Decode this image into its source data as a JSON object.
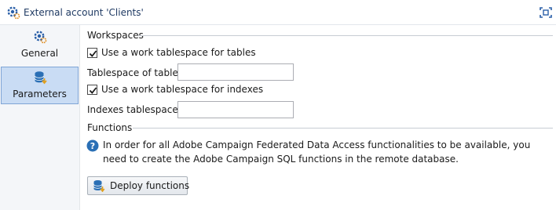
{
  "window": {
    "title": "External account 'Clients'"
  },
  "sidebar": {
    "items": [
      {
        "label": "General",
        "icon": "gear-icon",
        "selected": false
      },
      {
        "label": "Parameters",
        "icon": "database-icon",
        "selected": true
      }
    ]
  },
  "workspaces": {
    "section_title": "Workspaces",
    "tables_checkbox": {
      "label": "Use a work tablespace for tables",
      "checked": true
    },
    "tables_field": {
      "label": "Tablespace of tables:",
      "value": ""
    },
    "indexes_checkbox": {
      "label": "Use a work tablespace for indexes",
      "checked": true
    },
    "indexes_field": {
      "label": "Indexes tablespace:",
      "value": ""
    }
  },
  "functions": {
    "section_title": "Functions",
    "info_text": "In order for all Adobe Campaign Federated Data Access functionalities to be available, you need to create the Adobe Campaign SQL functions in the remote database.",
    "deploy_button": "Deploy functions"
  },
  "colors": {
    "accent": "#1f3a63",
    "selected_nav_bg": "#c9dcf4",
    "selected_nav_border": "#7fa5d6",
    "info_icon": "#2a6fb5"
  }
}
